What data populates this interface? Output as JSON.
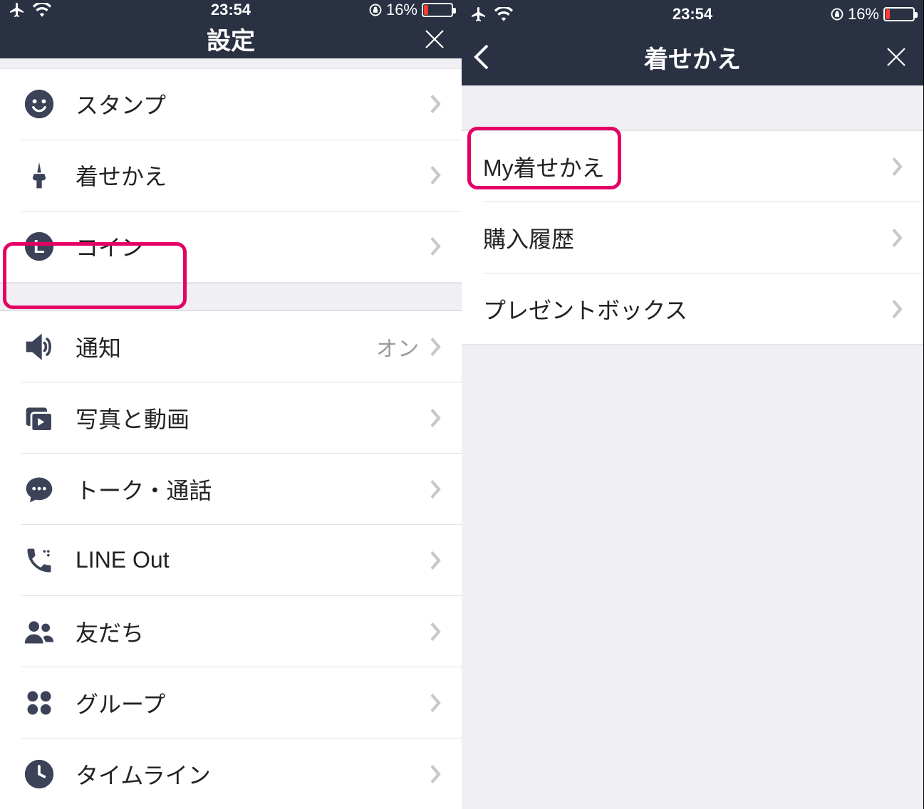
{
  "status": {
    "time": "23:54",
    "battery_pct": "16%"
  },
  "left": {
    "title": "設定",
    "group1": {
      "stamps": {
        "label": "スタンプ",
        "icon": "smile-icon"
      },
      "themes": {
        "label": "着せかえ",
        "icon": "paintbrush-icon"
      },
      "coins": {
        "label": "コイン",
        "icon": "coin-l-icon"
      }
    },
    "group2": {
      "notifications": {
        "label": "通知",
        "value": "オン",
        "icon": "speaker-icon"
      },
      "photos": {
        "label": "写真と動画",
        "icon": "media-icon"
      },
      "talk": {
        "label": "トーク・通話",
        "icon": "chat-icon"
      },
      "lineout": {
        "label": "LINE Out",
        "icon": "phone-icon"
      },
      "friends": {
        "label": "友だち",
        "icon": "friends-icon"
      },
      "groups": {
        "label": "グループ",
        "icon": "grid-icon"
      },
      "timeline": {
        "label": "タイムライン",
        "icon": "clock-icon"
      }
    }
  },
  "right": {
    "title": "着せかえ",
    "items": {
      "my_themes": {
        "label": "My着せかえ"
      },
      "history": {
        "label": "購入履歴"
      },
      "gift_box": {
        "label": "プレゼントボックス"
      }
    }
  }
}
